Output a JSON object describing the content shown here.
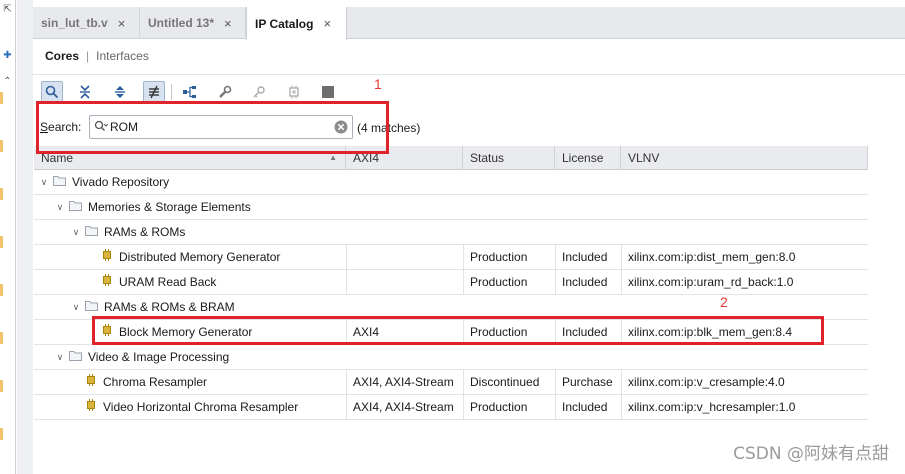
{
  "tabs": [
    {
      "label": "sin_lut_tb.v",
      "close": "×"
    },
    {
      "label": "Untitled 13*",
      "close": "×"
    },
    {
      "label": "IP Catalog",
      "close": "×"
    }
  ],
  "subtabs": {
    "active": "Cores",
    "separator": "|",
    "inactive": "Interfaces"
  },
  "toolbar_icons": [
    "search-icon",
    "collapse-all-icon",
    "expand-all-icon",
    "filter-icon",
    "hierarchy-icon",
    "wrench-icon",
    "key-icon",
    "chip-icon",
    "stop-icon"
  ],
  "search": {
    "label_prefix": "S",
    "label_rest": "earch:",
    "value": "ROM",
    "placeholder": "",
    "match_count": "(4 matches)"
  },
  "annotations": {
    "one": "1",
    "two": "2"
  },
  "columns": [
    "Name",
    "AXI4",
    "Status",
    "License",
    "VLNV"
  ],
  "rows": [
    {
      "level": 0,
      "kind": "folder",
      "name": "Vivado Repository",
      "axi": "",
      "status": "",
      "license": "",
      "vlnv": ""
    },
    {
      "level": 1,
      "kind": "folder",
      "name": "Memories & Storage Elements",
      "axi": "",
      "status": "",
      "license": "",
      "vlnv": ""
    },
    {
      "level": 2,
      "kind": "folder",
      "name": "RAMs & ROMs",
      "axi": "",
      "status": "",
      "license": "",
      "vlnv": ""
    },
    {
      "level": 3,
      "kind": "ip",
      "name": "Distributed Memory Generator",
      "axi": "",
      "status": "Production",
      "license": "Included",
      "vlnv": "xilinx.com:ip:dist_mem_gen:8.0"
    },
    {
      "level": 3,
      "kind": "ip",
      "name": "URAM Read Back",
      "axi": "",
      "status": "Production",
      "license": "Included",
      "vlnv": "xilinx.com:ip:uram_rd_back:1.0"
    },
    {
      "level": 2,
      "kind": "folder",
      "name": "RAMs & ROMs & BRAM",
      "axi": "",
      "status": "",
      "license": "",
      "vlnv": ""
    },
    {
      "level": 3,
      "kind": "ip",
      "name": "Block Memory Generator",
      "axi": "AXI4",
      "status": "Production",
      "license": "Included",
      "vlnv": "xilinx.com:ip:blk_mem_gen:8.4"
    },
    {
      "level": 1,
      "kind": "folder",
      "name": "Video & Image Processing",
      "axi": "",
      "status": "",
      "license": "",
      "vlnv": ""
    },
    {
      "level": 2,
      "kind": "ip",
      "name": "Chroma Resampler",
      "axi": "AXI4, AXI4-Stream",
      "status": "Discontinued",
      "license": "Purchase",
      "vlnv": "xilinx.com:ip:v_cresample:4.0"
    },
    {
      "level": 2,
      "kind": "ip",
      "name": "Video Horizontal Chroma Resampler",
      "axi": "AXI4, AXI4-Stream",
      "status": "Production",
      "license": "Included",
      "vlnv": "xilinx.com:ip:v_hcresampler:1.0"
    }
  ],
  "watermark": "CSDN @阿妹有点甜",
  "colors": {
    "accent_red": "#e0232b",
    "ip_icon": "#c9a227",
    "folder": "#9aa3ad"
  }
}
